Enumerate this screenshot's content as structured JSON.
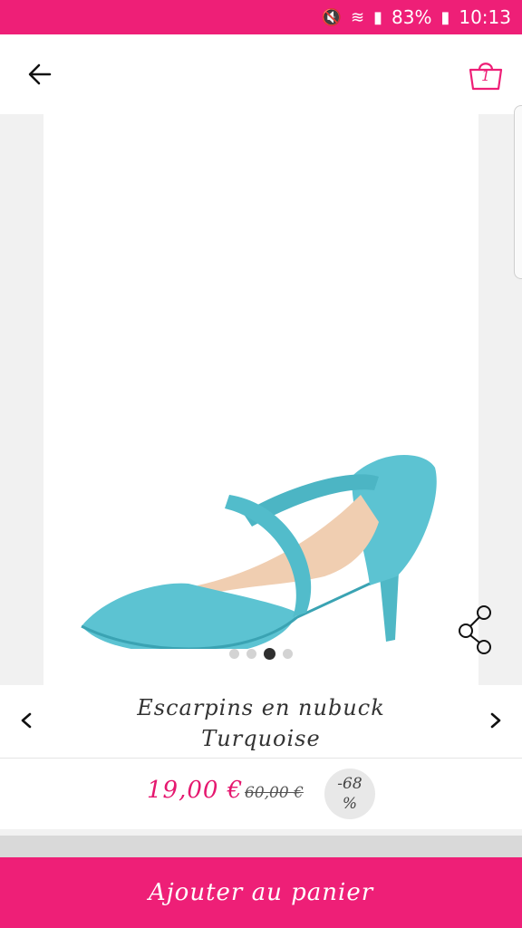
{
  "status_bar": {
    "battery": "83%",
    "time": "10:13",
    "icons": [
      "mute-icon",
      "wifi-icon",
      "signal-icon",
      "battery-icon"
    ]
  },
  "header": {
    "back_icon": "arrow-left-icon",
    "bag_icon": "shopping-bag-icon",
    "bag_count": "1"
  },
  "gallery": {
    "image_alt": "shoe-image",
    "dots_total": 4,
    "active_dot": 3,
    "share_icon": "share-icon"
  },
  "product": {
    "title_line1": "Escarpins en nubuck",
    "title_line2": "Turquoise",
    "price": "19,00 €",
    "old_price": "60,00 €",
    "discount_top": "-68",
    "discount_bottom": "%"
  },
  "actions": {
    "add_to_cart": "Ajouter au panier"
  },
  "colors": {
    "accent": "#ee1f77",
    "shoe": "#5cc3d2"
  }
}
